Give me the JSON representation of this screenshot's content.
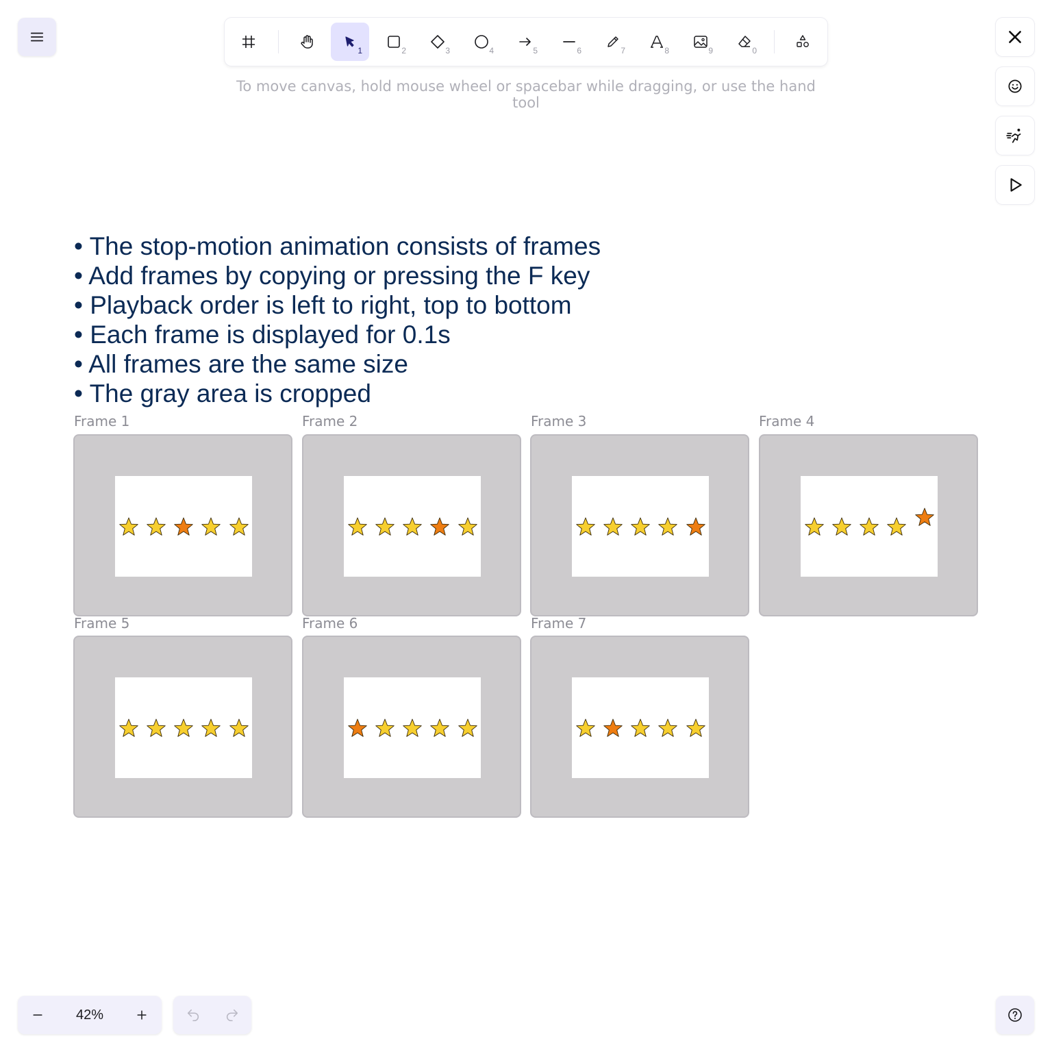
{
  "toolbar": {
    "tools": [
      {
        "name": "frame-tool",
        "icon": "frame-icon",
        "shortcut": ""
      },
      {
        "name": "hand-tool",
        "icon": "hand-icon",
        "shortcut": ""
      },
      {
        "name": "selection-tool",
        "icon": "pointer-icon",
        "shortcut": "1",
        "active": true
      },
      {
        "name": "rectangle-tool",
        "icon": "square-icon",
        "shortcut": "2"
      },
      {
        "name": "diamond-tool",
        "icon": "diamond-icon",
        "shortcut": "3"
      },
      {
        "name": "ellipse-tool",
        "icon": "circle-icon",
        "shortcut": "4"
      },
      {
        "name": "arrow-tool",
        "icon": "arrow-right-icon",
        "shortcut": "5"
      },
      {
        "name": "line-tool",
        "icon": "line-icon",
        "shortcut": "6"
      },
      {
        "name": "draw-tool",
        "icon": "pencil-icon",
        "shortcut": "7"
      },
      {
        "name": "text-tool",
        "icon": "text-icon",
        "shortcut": "8"
      },
      {
        "name": "image-tool",
        "icon": "image-icon",
        "shortcut": "9"
      },
      {
        "name": "eraser-tool",
        "icon": "eraser-icon",
        "shortcut": "0"
      },
      {
        "name": "more-shapes-tool",
        "icon": "shapes-icon",
        "shortcut": ""
      }
    ]
  },
  "hint": "To move canvas, hold mouse wheel or spacebar while dragging, or use the hand tool",
  "side_buttons": [
    "close-icon",
    "smiley-icon",
    "running-icon",
    "play-icon"
  ],
  "bullets": [
    "The stop-motion animation consists of frames",
    "Add frames by copying or pressing the F key",
    "Playback order is left to right, top to bottom",
    "Each frame is displayed for 0.1s",
    "All frames are the same size",
    "The gray area is cropped"
  ],
  "frames": [
    {
      "label": "Frame 1",
      "highlighted_star": 3,
      "raised": false
    },
    {
      "label": "Frame 2",
      "highlighted_star": 4,
      "raised": false
    },
    {
      "label": "Frame 3",
      "highlighted_star": 5,
      "raised": false
    },
    {
      "label": "Frame 4",
      "highlighted_star": 5,
      "raised": true
    },
    {
      "label": "Frame 5",
      "highlighted_star": 0,
      "raised": false
    },
    {
      "label": "Frame 6",
      "highlighted_star": 1,
      "raised": false
    },
    {
      "label": "Frame 7",
      "highlighted_star": 2,
      "raised": false
    }
  ],
  "colors": {
    "star_yellow": "#f7cf2f",
    "star_orange": "#ee7d12",
    "frame_gray": "#cdcbcd",
    "accent": "#e3e2fe"
  },
  "zoom": {
    "value": "42%"
  }
}
